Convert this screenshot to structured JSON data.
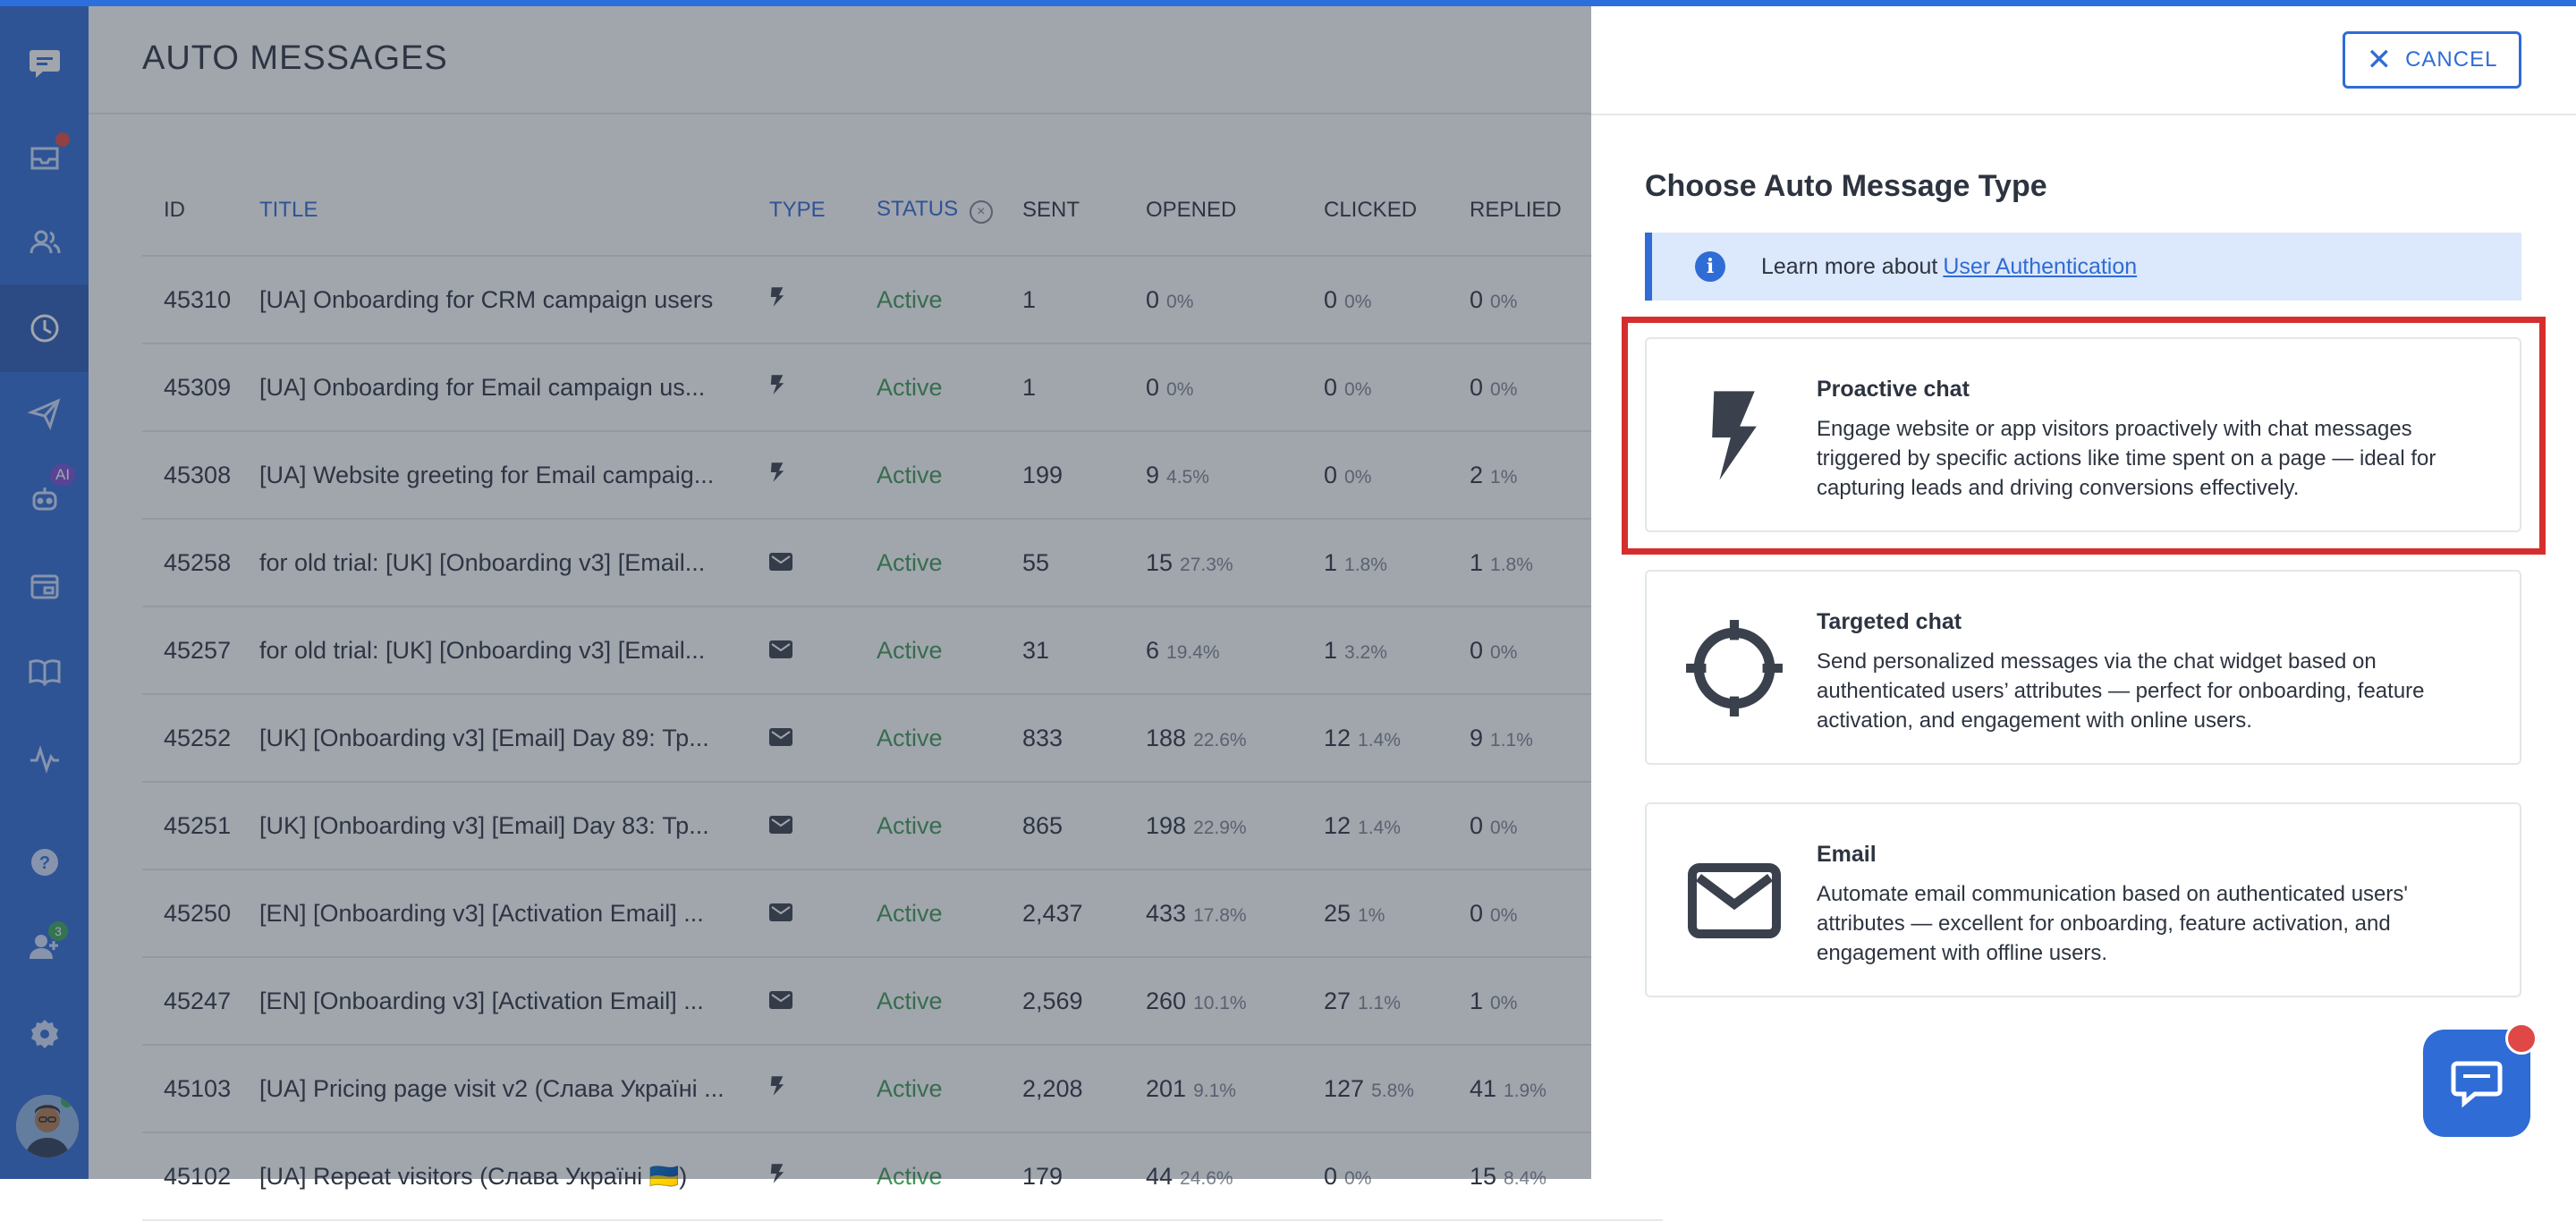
{
  "sidebar": {
    "items": [
      {
        "name": "chat-logo-icon"
      },
      {
        "name": "inbox-icon"
      },
      {
        "name": "contacts-icon"
      },
      {
        "name": "auto-messages-icon",
        "active": true
      },
      {
        "name": "send-icon"
      },
      {
        "name": "ai-bot-icon",
        "badge": "AI"
      },
      {
        "name": "widget-icon"
      },
      {
        "name": "knowledge-base-icon"
      },
      {
        "name": "analytics-icon"
      },
      {
        "name": "help-icon"
      },
      {
        "name": "team-icon",
        "badge": "3"
      },
      {
        "name": "settings-icon"
      }
    ]
  },
  "main": {
    "title": "AUTO MESSAGES",
    "columns": {
      "id": "ID",
      "title": "TITLE",
      "type": "TYPE",
      "status": "STATUS",
      "sent": "SENT",
      "opened": "OPENED",
      "clicked": "CLICKED",
      "replied": "REPLIED"
    },
    "rows": [
      {
        "id": "45310",
        "title": "[UA] Onboarding for CRM campaign users",
        "type": "lightning-icon",
        "status": "Active",
        "sent": "1",
        "opened": "0",
        "opened_pct": "0%",
        "clicked": "0",
        "clicked_pct": "0%",
        "replied": "0",
        "replied_pct": "0%"
      },
      {
        "id": "45309",
        "title": "[UA] Onboarding for Email campaign us...",
        "type": "lightning-icon",
        "status": "Active",
        "sent": "1",
        "opened": "0",
        "opened_pct": "0%",
        "clicked": "0",
        "clicked_pct": "0%",
        "replied": "0",
        "replied_pct": "0%"
      },
      {
        "id": "45308",
        "title": "[UA] Website greeting for Email campaig...",
        "type": "lightning-icon",
        "status": "Active",
        "sent": "199",
        "opened": "9",
        "opened_pct": "4.5%",
        "clicked": "0",
        "clicked_pct": "0%",
        "replied": "2",
        "replied_pct": "1%"
      },
      {
        "id": "45258",
        "title": "for old trial: [UK] [Onboarding v3] [Email...",
        "type": "envelope-icon",
        "status": "Active",
        "sent": "55",
        "opened": "15",
        "opened_pct": "27.3%",
        "clicked": "1",
        "clicked_pct": "1.8%",
        "replied": "1",
        "replied_pct": "1.8%"
      },
      {
        "id": "45257",
        "title": "for old trial: [UK] [Onboarding v3] [Email...",
        "type": "envelope-icon",
        "status": "Active",
        "sent": "31",
        "opened": "6",
        "opened_pct": "19.4%",
        "clicked": "1",
        "clicked_pct": "3.2%",
        "replied": "0",
        "replied_pct": "0%"
      },
      {
        "id": "45252",
        "title": "[UK] [Onboarding v3] [Email] Day 89: Тр...",
        "type": "envelope-icon",
        "status": "Active",
        "sent": "833",
        "opened": "188",
        "opened_pct": "22.6%",
        "clicked": "12",
        "clicked_pct": "1.4%",
        "replied": "9",
        "replied_pct": "1.1%"
      },
      {
        "id": "45251",
        "title": "[UK] [Onboarding v3] [Email] Day 83: Тр...",
        "type": "envelope-icon",
        "status": "Active",
        "sent": "865",
        "opened": "198",
        "opened_pct": "22.9%",
        "clicked": "12",
        "clicked_pct": "1.4%",
        "replied": "0",
        "replied_pct": "0%"
      },
      {
        "id": "45250",
        "title": "[EN] [Onboarding v3] [Activation Email] ...",
        "type": "envelope-icon",
        "status": "Active",
        "sent": "2,437",
        "opened": "433",
        "opened_pct": "17.8%",
        "clicked": "25",
        "clicked_pct": "1%",
        "replied": "0",
        "replied_pct": "0%"
      },
      {
        "id": "45247",
        "title": "[EN] [Onboarding v3] [Activation Email] ...",
        "type": "envelope-icon",
        "status": "Active",
        "sent": "2,569",
        "opened": "260",
        "opened_pct": "10.1%",
        "clicked": "27",
        "clicked_pct": "1.1%",
        "replied": "1",
        "replied_pct": "0%"
      },
      {
        "id": "45103",
        "title": "[UA] Pricing page visit v2 (Слава Україні ...",
        "type": "lightning-icon",
        "status": "Active",
        "sent": "2,208",
        "opened": "201",
        "opened_pct": "9.1%",
        "clicked": "127",
        "clicked_pct": "5.8%",
        "replied": "41",
        "replied_pct": "1.9%"
      },
      {
        "id": "45102",
        "title": "[UA] Repeat visitors (Слава Україні 🇺🇦)",
        "type": "lightning-icon",
        "status": "Active",
        "sent": "179",
        "opened": "44",
        "opened_pct": "24.6%",
        "clicked": "0",
        "clicked_pct": "0%",
        "replied": "15",
        "replied_pct": "8.4%"
      }
    ]
  },
  "panel": {
    "cancel_label": "CANCEL",
    "title": "Choose Auto Message Type",
    "info_text": "Learn more about",
    "info_link": "User Authentication",
    "cards": [
      {
        "icon": "lightning-icon",
        "title": "Proactive chat",
        "description": "Engage website or app visitors proactively with chat messages triggered by specific actions like time spent on a page — ideal for capturing leads and driving conversions effectively."
      },
      {
        "icon": "target-icon",
        "title": "Targeted chat",
        "description": "Send personalized messages via the chat widget based on authenticated users’ attributes — perfect for onboarding, feature activation, and engagement with online users."
      },
      {
        "icon": "envelope-icon",
        "title": "Email",
        "description": "Automate email communication based on authenticated users' attributes — excellent for onboarding, feature activation, and engagement with offline users."
      }
    ]
  },
  "colors": {
    "accent": "#2f6cd6",
    "status_active": "#3f9a55",
    "highlight": "#d62e2e"
  }
}
